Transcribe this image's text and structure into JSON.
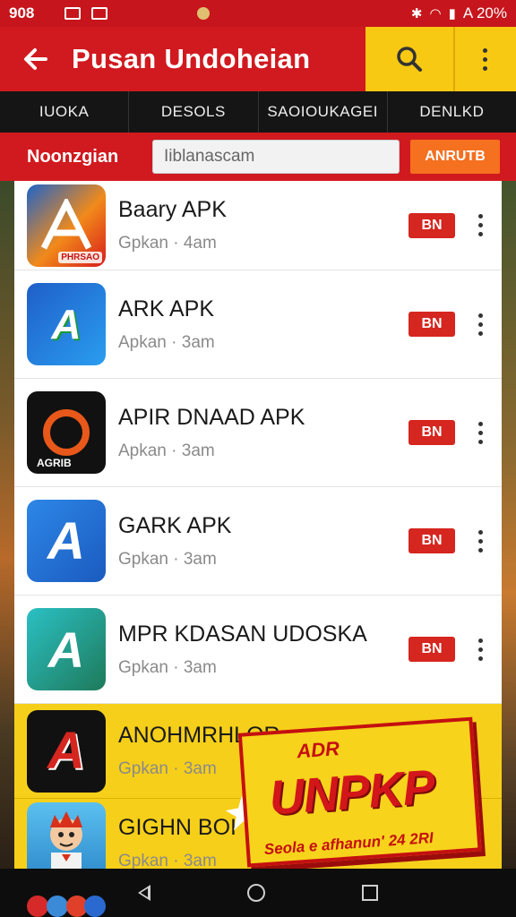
{
  "status_bar": {
    "time": "908",
    "right_text": "A 20%"
  },
  "app_bar": {
    "title": "Pusan Undoheian"
  },
  "tabs": [
    "IUOKA",
    "DESOLS",
    "SAOIOUKAGEI",
    "DENLKD"
  ],
  "search": {
    "label": "Noonzgian",
    "placeholder": "Iiblanascam",
    "button": "ANRUTB"
  },
  "apps": [
    {
      "name": "Baary APK",
      "meta": "Gpkan · 4am",
      "badge": "BN",
      "icon": "app-icon-stylized-a",
      "icon_text": "PHRSAO"
    },
    {
      "name": "ARK  APK",
      "meta": "Apkan · 3am",
      "badge": "BN",
      "icon": "app-icon-letter-a",
      "icon_text": "A"
    },
    {
      "name": "APIR DNAAD APK",
      "meta": "Apkan · 3am",
      "badge": "BN",
      "icon": "app-icon-ring",
      "icon_text": "AGRIB"
    },
    {
      "name": "GARK APK",
      "meta": "Gpkan · 3am",
      "badge": "BN",
      "icon": "app-icon-letter-a",
      "icon_text": "A"
    },
    {
      "name": "MPR KDASAN UDOSKA",
      "meta": "Gpkan · 3am",
      "badge": "BN",
      "icon": "app-icon-letter-a",
      "icon_text": "A"
    },
    {
      "name": "ANOHMRHLOR",
      "meta": "Gpkan · 3am",
      "badge": "",
      "icon": "app-icon-letter-a",
      "icon_text": "A"
    },
    {
      "name": "GIGHN BOI",
      "meta": "Gpkan · 3am",
      "badge": "",
      "icon": "app-icon-cartoon",
      "icon_text": ""
    }
  ],
  "promo": {
    "top": "ADR",
    "main": "UNPKP",
    "sub": "Seola e afhanun' 24 2RI"
  },
  "colors": {
    "primary_red": "#d01a1f",
    "accent_yellow": "#f7c913",
    "badge_red": "#d5261f",
    "button_orange": "#f5701f"
  }
}
